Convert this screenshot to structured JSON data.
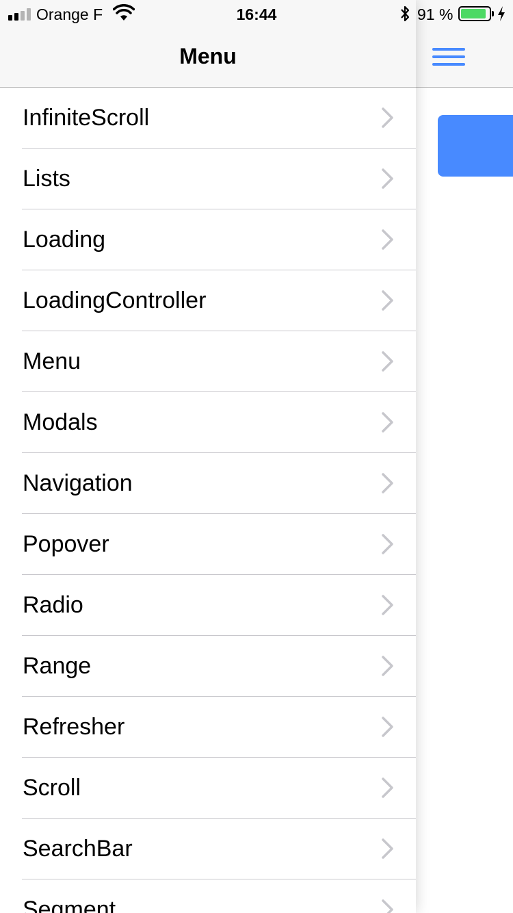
{
  "status_bar": {
    "carrier": "Orange F",
    "time": "16:44",
    "battery_percent": "91 %",
    "battery_level": 0.91,
    "signal_bars_filled": 2,
    "signal_bars_total": 4
  },
  "menu": {
    "title": "Menu",
    "items": [
      {
        "label": "InfiniteScroll"
      },
      {
        "label": "Lists"
      },
      {
        "label": "Loading"
      },
      {
        "label": "LoadingController"
      },
      {
        "label": "Menu"
      },
      {
        "label": "Modals"
      },
      {
        "label": "Navigation"
      },
      {
        "label": "Popover"
      },
      {
        "label": "Radio"
      },
      {
        "label": "Range"
      },
      {
        "label": "Refresher"
      },
      {
        "label": "Scroll"
      },
      {
        "label": "SearchBar"
      },
      {
        "label": "Segment"
      }
    ]
  },
  "colors": {
    "accent": "#488aff",
    "battery_fill": "#4cd964",
    "header_bg": "#f7f7f7",
    "divider": "#c8c7cc",
    "chevron": "#c7c7cc"
  },
  "icons": {
    "chevron": "chevron-right-icon",
    "menu_toggle": "hamburger-menu-icon"
  }
}
